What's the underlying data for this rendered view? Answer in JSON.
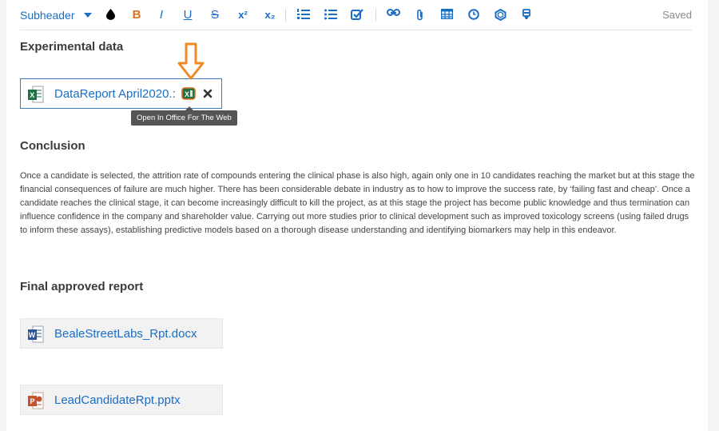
{
  "toolbar": {
    "style_select": "Subheader",
    "buttons": [
      {
        "name": "text-color-icon",
        "glyph": "ink"
      },
      {
        "name": "bold-button",
        "label": "B"
      },
      {
        "name": "italic-button",
        "label": "I"
      },
      {
        "name": "underline-button",
        "label": "U"
      },
      {
        "name": "strikethrough-button",
        "label": "S"
      },
      {
        "name": "superscript-button",
        "label": "x²"
      },
      {
        "name": "subscript-button",
        "label": "x₂"
      },
      {
        "name": "ordered-list-icon"
      },
      {
        "name": "bullet-list-icon"
      },
      {
        "name": "checklist-icon"
      },
      {
        "name": "link-icon"
      },
      {
        "name": "attachment-icon"
      },
      {
        "name": "table-icon"
      },
      {
        "name": "clock-icon"
      },
      {
        "name": "chemical-structure-icon"
      },
      {
        "name": "marker-icon"
      }
    ],
    "status": "Saved"
  },
  "sections": {
    "experimental": {
      "heading": "Experimental data",
      "file": "DataReport April2020.:",
      "tooltip": "Open In Office For The Web"
    },
    "conclusion": {
      "heading": "Conclusion",
      "text": "Once a candidate is selected, the attrition rate of compounds entering the clinical phase is also high, again only one in 10 candidates reaching the market but at this stage the financial consequences of failure are much higher. There has been considerable debate in industry as to how to improve the success rate, by ‘failing fast and cheap’. Once a candidate reaches the clinical stage, it can become increasingly difficult to kill the project, as at this stage the project has become public knowledge and thus termination can influence confidence in the company and shareholder value. Carrying out more studies prior to clinical development such as improved toxicology screens (using failed drugs to inform these assays), establishing predictive models based on a thorough disease understanding and identifying biomarkers may help in this endeavor."
    },
    "final": {
      "heading": "Final approved report",
      "files": [
        "BealeStreetLabs_Rpt.docx",
        "LeadCandidateRpt.pptx"
      ]
    }
  },
  "colors": {
    "link": "#1a6ec4",
    "bold_accent": "#e07020",
    "excel": "#1f7244",
    "word": "#2b579a",
    "powerpoint": "#c5502a",
    "highlight_arrow": "#f08a24"
  }
}
